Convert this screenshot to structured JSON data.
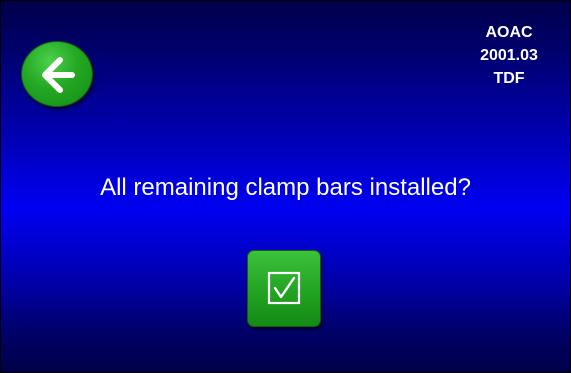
{
  "header": {
    "method_line1": "AOAC",
    "method_line2": "2001.03",
    "method_line3": "TDF"
  },
  "back_button": {
    "icon": "arrow-left-icon",
    "color": "#22a322"
  },
  "prompt": {
    "text": "All remaining clamp bars installed?"
  },
  "confirm_button": {
    "icon": "checkbox-checked-icon",
    "color": "#22a322"
  },
  "colors": {
    "background_center": "#0000f2",
    "background_edge": "#00004a",
    "text": "#ffffff"
  }
}
